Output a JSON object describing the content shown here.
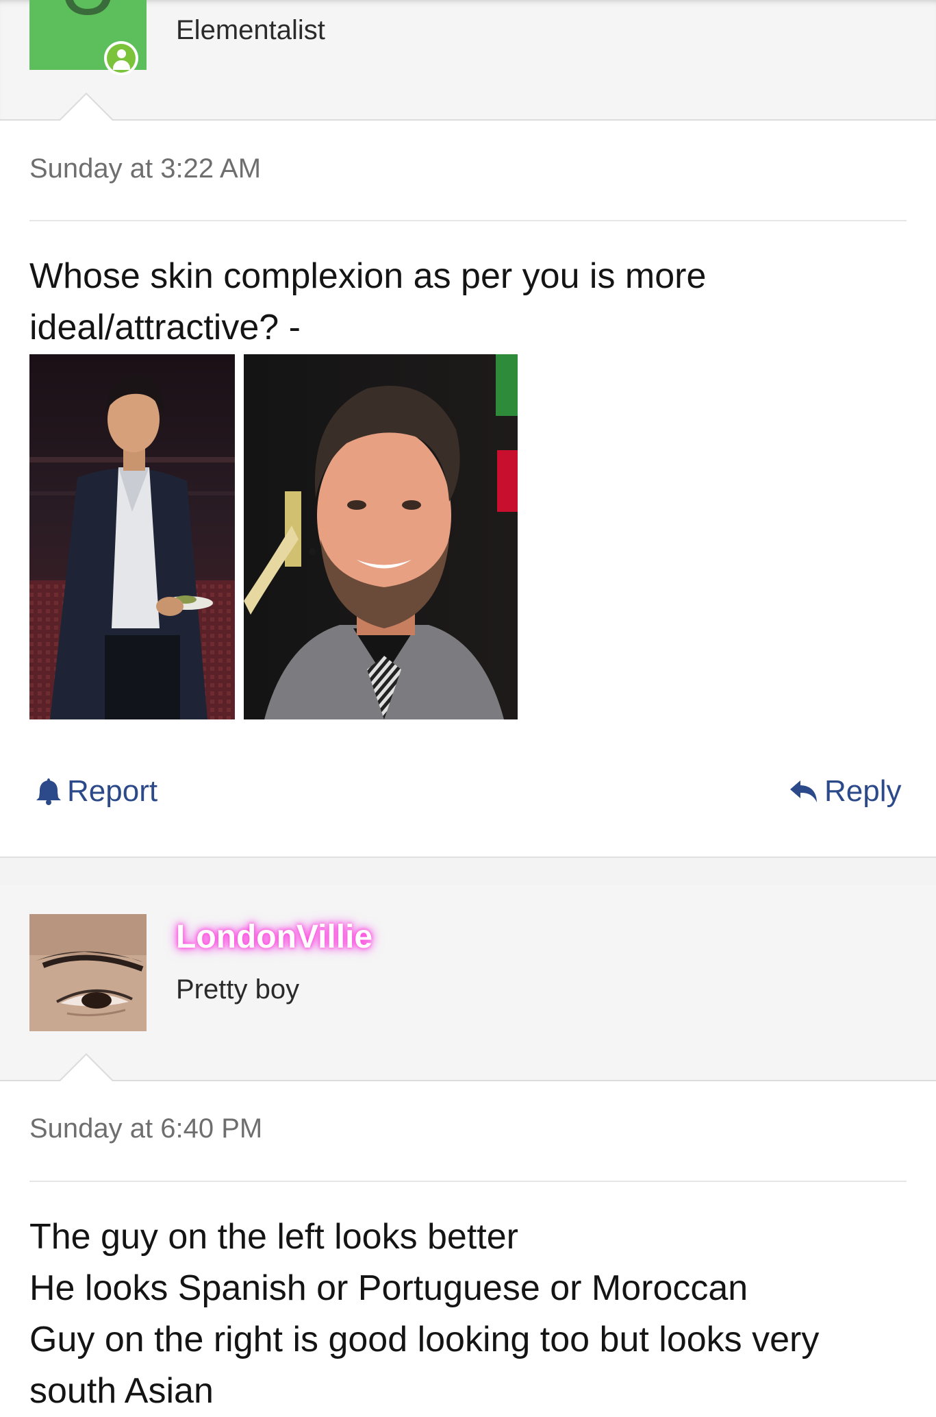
{
  "post1": {
    "avatar_letter": "U",
    "username": "Elementalist",
    "timestamp": "Sunday at 3:22 AM",
    "text_line1": "Whose skin complexion as per you is more",
    "text_line2": "ideal/attractive? -",
    "images": [
      {
        "alt": "Man in dark suit holding a plate"
      },
      {
        "alt": "Smiling bearded man in grey suit"
      }
    ],
    "report_label": "Report",
    "reply_label": "Reply"
  },
  "post2": {
    "username": "LondonVillie",
    "user_title": "Pretty boy",
    "timestamp": "Sunday at 6:40 PM",
    "text_lines": [
      "The guy on the left looks better",
      "He looks Spanish or Portuguese or Moroccan",
      "Guy on the right is good looking too but looks very",
      "south Asian"
    ]
  },
  "colors": {
    "link_blue": "#2c4a8a",
    "avatar_green": "#5cbf5c",
    "online_green": "#7ac33a",
    "glow_pink": "#ff3fd8"
  }
}
